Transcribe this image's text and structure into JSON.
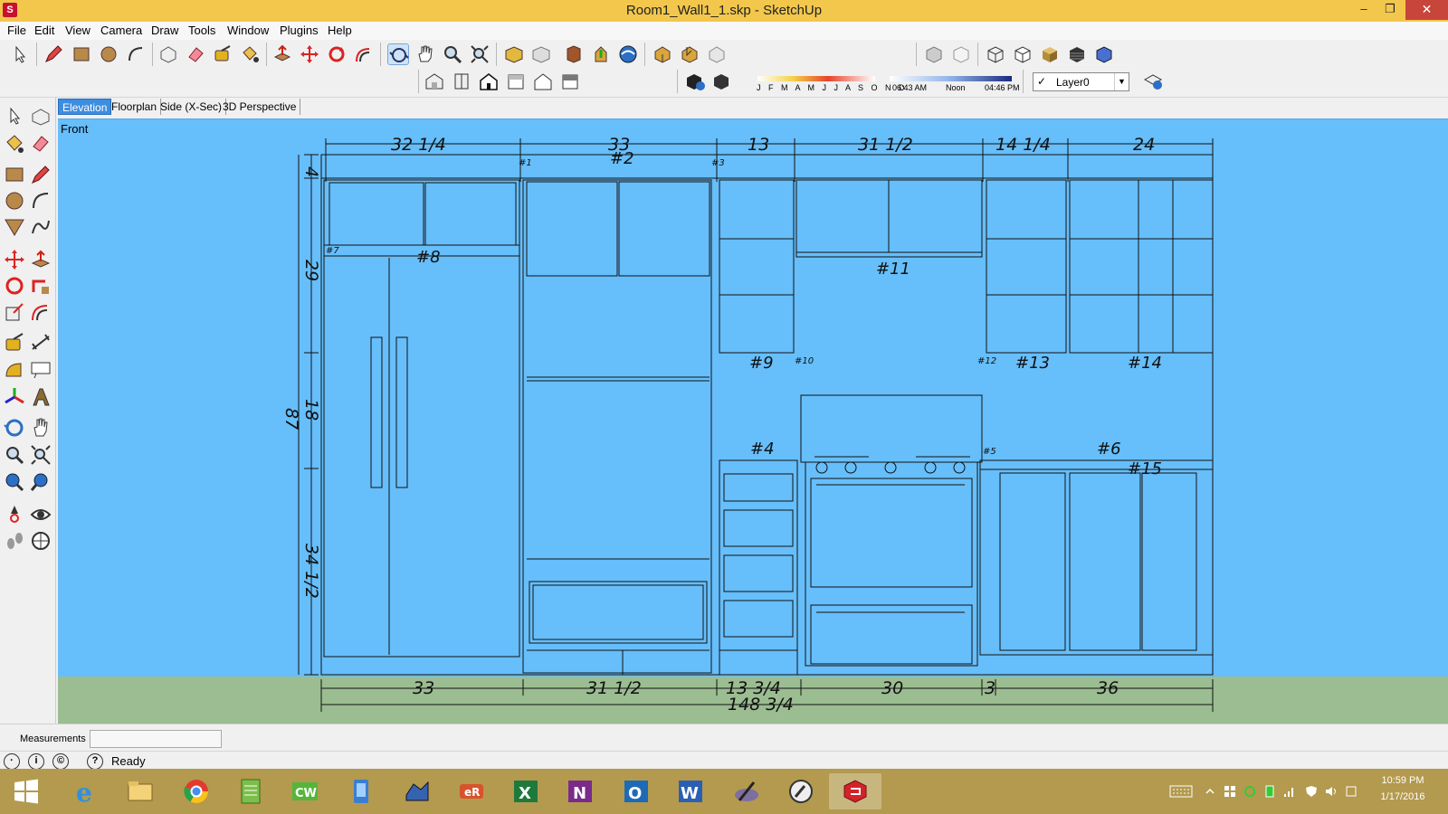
{
  "window": {
    "title": "Room1_Wall1_1.skp - SketchUp",
    "minimize": "–",
    "maximize": "❐",
    "close": "✕"
  },
  "menu": [
    "File",
    "Edit",
    "View",
    "Camera",
    "Draw",
    "Tools",
    "Window",
    "Plugins",
    "Help"
  ],
  "shadow": {
    "months": "J F M A M J J A S O N D",
    "time_start": "06:43 AM",
    "time_noon": "Noon",
    "time_end": "04:46 PM"
  },
  "layer": {
    "name": "Layer0",
    "checked": "✓"
  },
  "tabs": [
    {
      "label": "Elevation",
      "active": true
    },
    {
      "label": "Floorplan",
      "active": false
    },
    {
      "label": "Side (X-Sec)",
      "active": false
    },
    {
      "label": "3D Perspective",
      "active": false
    }
  ],
  "viewport": {
    "view_label": "Front",
    "sky_color": "#66befa",
    "ground_color": "#9bbd91",
    "top_dims": [
      "32  1/4",
      "33",
      "13",
      "31  1/2",
      "14  1/4",
      "24"
    ],
    "bottom_dims": [
      "33",
      "31  1/2",
      "13  3/4",
      "30",
      "3",
      "36"
    ],
    "overall_width": "148  3/4",
    "left_dims": [
      "4",
      "29",
      "18",
      "34  1/2"
    ],
    "overall_height": "87",
    "cabinet_labels": [
      "#1",
      "#2",
      "#3",
      "#4",
      "#5",
      "#6",
      "#7",
      "#8",
      "#9",
      "#10",
      "#11",
      "#12",
      "#13",
      "#14",
      "#15"
    ]
  },
  "measurements": {
    "label": "Measurements",
    "value": ""
  },
  "status": {
    "text": "Ready",
    "help_glyph": "?"
  },
  "taskbar": {
    "apps": [
      "start",
      "internet-explorer",
      "file-explorer",
      "chrome",
      "spreadsheet-app",
      "cw-app",
      "blue-app",
      "network-app",
      "er-app",
      "excel",
      "onenote",
      "outlook",
      "word",
      "pen-app",
      "tools-app",
      "sketchup"
    ],
    "time": "10:59 PM",
    "date": "1/17/2016"
  },
  "colors": {
    "titlebar": "#f2c74c",
    "taskbar": "#b39a4e",
    "active_tab": "#3d8de0"
  }
}
